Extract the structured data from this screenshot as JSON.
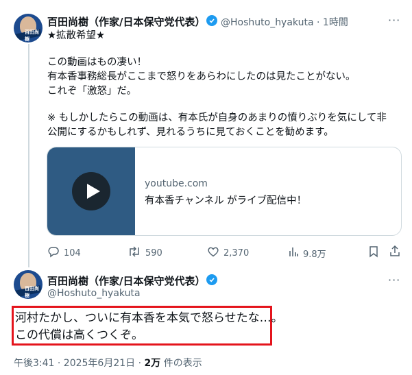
{
  "tweet1": {
    "author": "百田尚樹（作家/日本保守党代表）",
    "handle": "@Hoshuto_hyakuta",
    "time": "1時間",
    "avatar_text": "百田尚樹",
    "lines": [
      "★拡散希望★",
      "この動画はもの凄い！",
      "有本香事務総長がここまで怒りをあらわにしたのは見たことがない。",
      "これぞ「激怒」だ。",
      "※ もしかしたらこの動画は、有本氏が自身のあまりの憤りぶりを気にして非",
      "公開にするかもしれず、見れるうちに見ておくことを勧めます。"
    ],
    "card": {
      "domain": "youtube.com",
      "title": "有本香チャンネル がライブ配信中！"
    },
    "stats": {
      "replies": "104",
      "retweets": "590",
      "likes": "2,370",
      "views": "9.8万"
    }
  },
  "tweet2": {
    "author": "百田尚樹（作家/日本保守党代表）",
    "handle": "@Hoshuto_hyakuta",
    "avatar_text": "百田尚樹",
    "lines": [
      "河村たかし、ついに有本香を本気で怒らせたな…。",
      "この代償は高くつくぞ。"
    ],
    "timestamp": "午後3:41 · 2025年6月21日 · ",
    "views_count": "2万",
    "views_label": " 件の表示"
  },
  "icons": {
    "verified": "verified-badge-icon",
    "more": "more-icon",
    "reply": "reply-icon",
    "retweet": "retweet-icon",
    "like": "heart-icon",
    "views": "views-chart-icon",
    "bookmark": "bookmark-icon",
    "share": "share-icon",
    "play": "play-icon"
  },
  "colors": {
    "accent": "#1d9bf0",
    "highlight": "#e4141c",
    "muted": "#536471"
  }
}
